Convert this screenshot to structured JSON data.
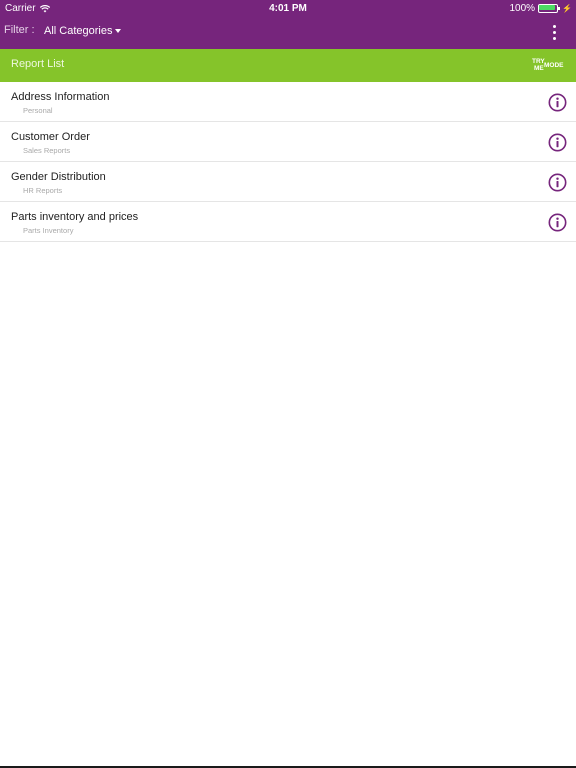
{
  "status_bar": {
    "carrier": "Carrier",
    "wifi_icon": "wifi-icon",
    "time": "4:01 PM",
    "battery_percent": "100%",
    "battery_level": 1.0,
    "battery_icon": "battery-icon",
    "charging_icon": "⚡",
    "battery_color": "#4cd964"
  },
  "header": {
    "filter_label": "Filter :",
    "filter_value": "All Categories",
    "caret_icon": "caret-down-icon",
    "menu_icon": "more-vertical-icon",
    "background": "#76257c"
  },
  "subheader": {
    "title": "Report List",
    "badge_try": "TRY",
    "badge_me": "ME",
    "badge_mode": "MODE",
    "background": "#85c42a"
  },
  "reports": [
    {
      "title": "Address Information",
      "category": "Personal",
      "info_icon": "info-icon"
    },
    {
      "title": "Customer Order",
      "category": "Sales Reports",
      "info_icon": "info-icon"
    },
    {
      "title": "Gender Distribution",
      "category": "HR Reports",
      "info_icon": "info-icon"
    },
    {
      "title": "Parts inventory and prices",
      "category": "Parts Inventory",
      "info_icon": "info-icon"
    }
  ],
  "info_icon_color": "#76257c"
}
